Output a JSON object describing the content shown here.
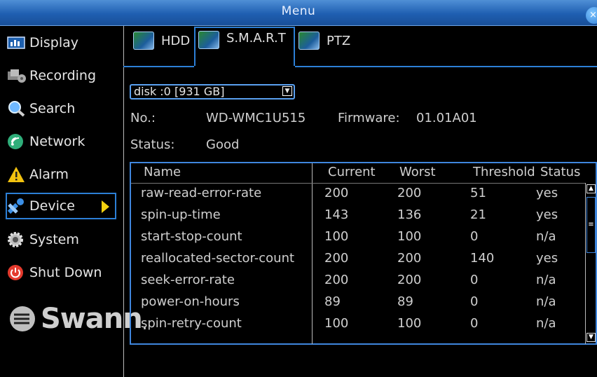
{
  "window": {
    "title": "Menu",
    "close_glyph": "×"
  },
  "sidebar": {
    "items": [
      {
        "label": "Display",
        "icon": "display-icon"
      },
      {
        "label": "Recording",
        "icon": "recording-icon"
      },
      {
        "label": "Search",
        "icon": "search-icon"
      },
      {
        "label": "Network",
        "icon": "network-icon"
      },
      {
        "label": "Alarm",
        "icon": "alarm-icon"
      },
      {
        "label": "Device",
        "icon": "device-icon",
        "active": true
      },
      {
        "label": "System",
        "icon": "system-icon"
      },
      {
        "label": "Shut Down",
        "icon": "power-icon"
      }
    ],
    "logo_text": "Swann",
    "logo_suffix": "."
  },
  "tabs": [
    {
      "label": "HDD"
    },
    {
      "label": "S.M.A.R.T",
      "active": true
    },
    {
      "label": "PTZ"
    }
  ],
  "disk_select": {
    "value": "disk :0 [931 GB]"
  },
  "info": {
    "no_label": "No.:",
    "no_value": "WD-WMC1U515",
    "firmware_label": "Firmware:",
    "firmware_value": "01.01A01",
    "status_label": "Status:",
    "status_value": "Good"
  },
  "table": {
    "headers": [
      "Name",
      "Current",
      "Worst",
      "Threshold",
      "Status"
    ],
    "rows": [
      [
        "raw-read-error-rate",
        "200",
        "200",
        "51",
        "yes"
      ],
      [
        "spin-up-time",
        "143",
        "136",
        "21",
        "yes"
      ],
      [
        "start-stop-count",
        "100",
        "100",
        "0",
        "n/a"
      ],
      [
        "reallocated-sector-count",
        "200",
        "200",
        "140",
        "yes"
      ],
      [
        "seek-error-rate",
        "200",
        "200",
        "0",
        "n/a"
      ],
      [
        "power-on-hours",
        "89",
        "89",
        "0",
        "n/a"
      ],
      [
        "spin-retry-count",
        "100",
        "100",
        "0",
        "n/a"
      ]
    ]
  },
  "colors": {
    "accent": "#2c7fd6",
    "title_bar": "#1f5fb1",
    "arrow": "#f5d20f"
  }
}
